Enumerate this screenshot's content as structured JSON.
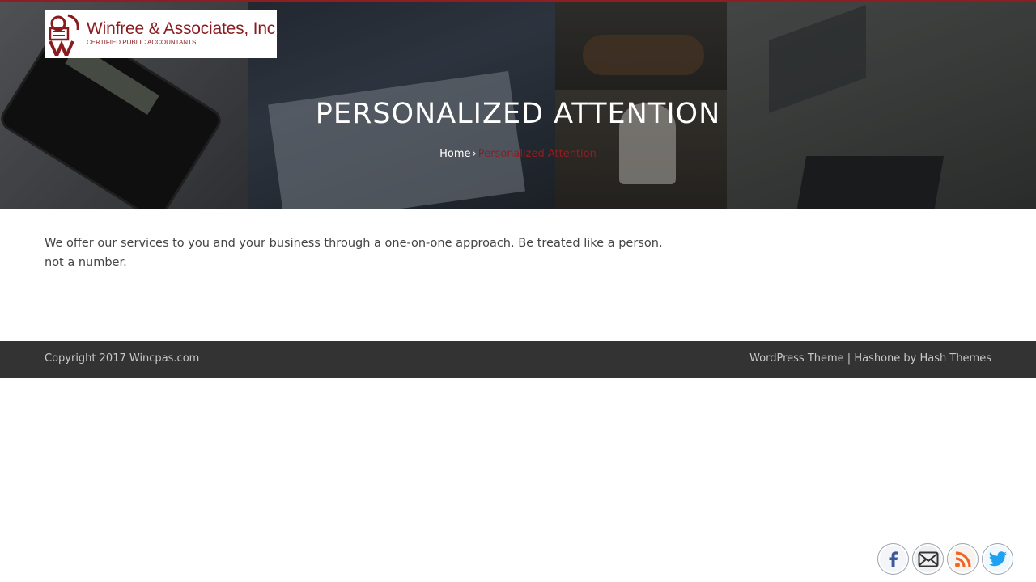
{
  "brand": {
    "name": "Winfree & Associates, Inc.",
    "tagline": "CERTIFIED PUBLIC ACCOUNTANTS",
    "accent_color": "#8f1e22"
  },
  "hero": {
    "title": "PERSONALIZED ATTENTION",
    "breadcrumb": {
      "home": "Home",
      "separator": "›",
      "current": "Personalized Attention"
    }
  },
  "content": {
    "body": "We offer our services to you and your business through a one-on-one approach. Be treated like a person, not a number."
  },
  "footer": {
    "copyright": "Copyright 2017 Wincpas.com",
    "theme_prefix": "WordPress Theme | ",
    "theme_link": "Hashone",
    "theme_suffix": " by Hash Themes",
    "background_color": "#333333"
  },
  "social": [
    {
      "name": "facebook",
      "icon": "facebook-icon",
      "color": "#3b5998"
    },
    {
      "name": "email",
      "icon": "envelope-icon",
      "color": "#333333"
    },
    {
      "name": "rss",
      "icon": "rss-icon",
      "color": "#f26522"
    },
    {
      "name": "twitter",
      "icon": "twitter-icon",
      "color": "#1da1f2"
    }
  ]
}
